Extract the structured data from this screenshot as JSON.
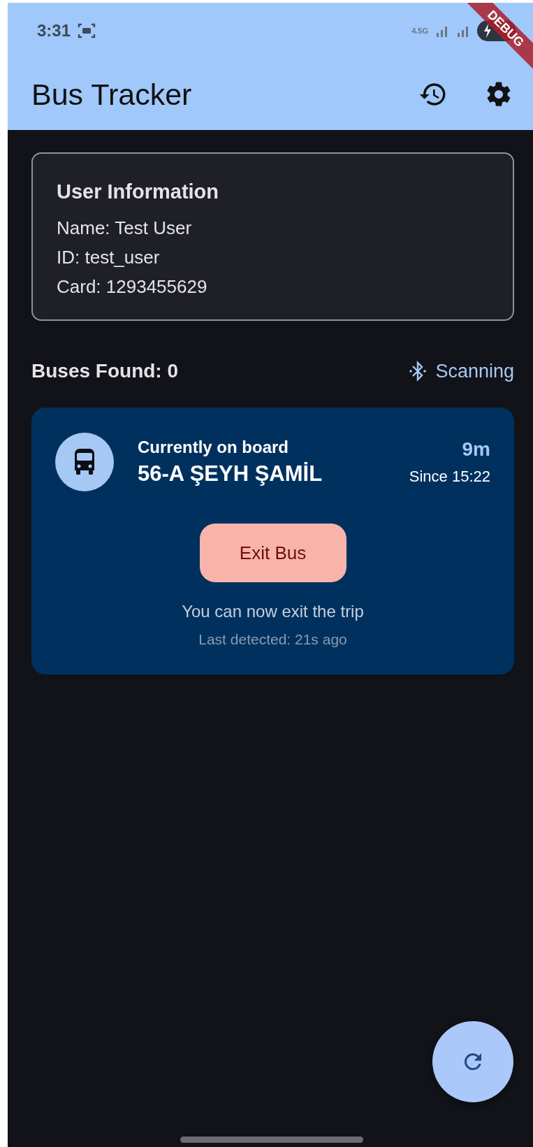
{
  "status_bar": {
    "time": "3:31",
    "network": "4.5G"
  },
  "debug_banner": {
    "label": "DEBUG"
  },
  "app_bar": {
    "title": "Bus Tracker"
  },
  "user_card": {
    "title": "User Information",
    "lines": [
      "Name: Test User",
      "ID: test_user",
      "Card: 1293455629"
    ]
  },
  "scan": {
    "label": "Buses Found: 0",
    "status": "Scanning"
  },
  "trip": {
    "heading": "Currently on board",
    "route": "56-A ŞEYH ŞAMİL",
    "duration": "9m",
    "since": "Since 15:22",
    "button": "Exit Bus",
    "message": "You can now exit the trip",
    "last_detected": "Last detected: 21s ago"
  }
}
